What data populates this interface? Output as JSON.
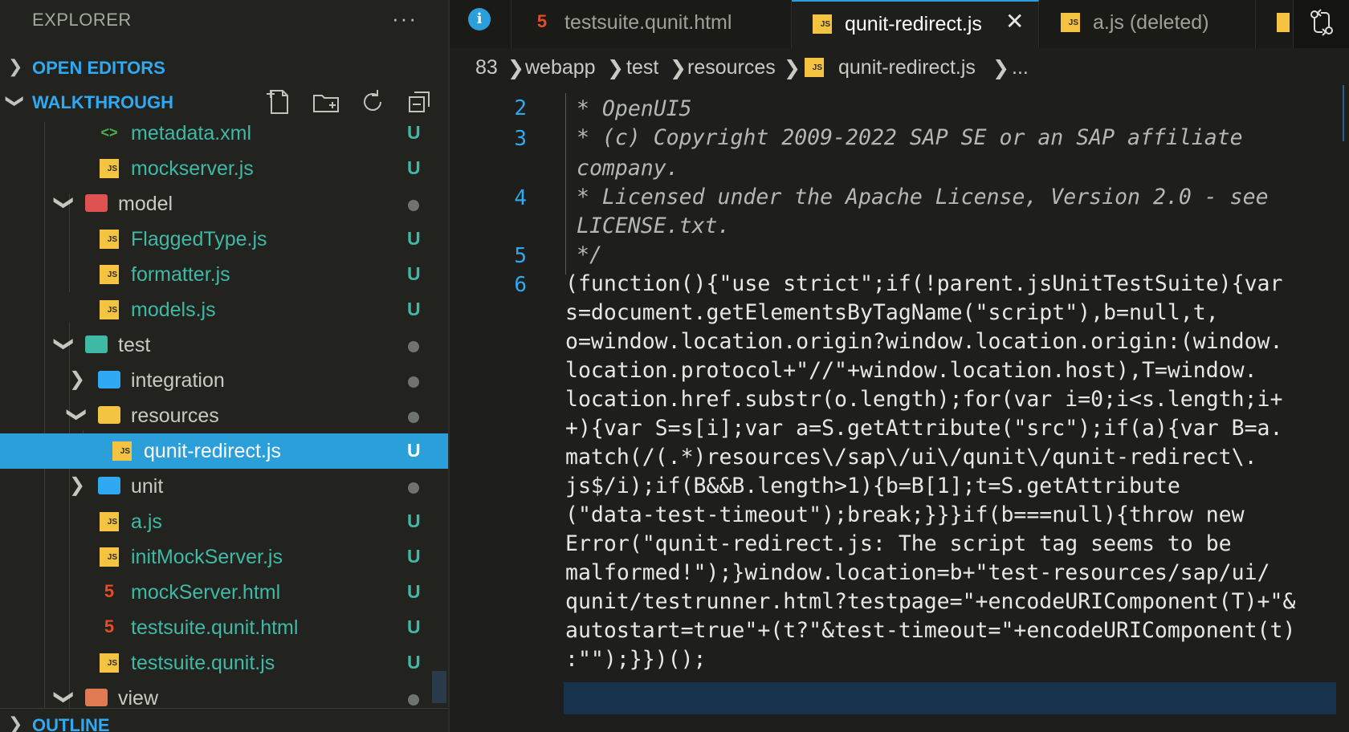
{
  "sidebar": {
    "title": "EXPLORER",
    "more": "···",
    "open_editors": "OPEN EDITORS",
    "walkthrough": "WALKTHROUGH",
    "outline": "OUTLINE",
    "tree": [
      {
        "name": "metadata.xml",
        "icon": "xml-file-icon",
        "status": "U",
        "color": "#3fb8a6"
      },
      {
        "name": "mockserver.js",
        "icon": "js-file-icon",
        "status": "U",
        "color": "#3fb8a6"
      },
      {
        "name": "model",
        "icon": "folder-red-open-icon",
        "status": "dot",
        "color": "#c8cbc4"
      },
      {
        "name": "FlaggedType.js",
        "icon": "js-file-icon",
        "status": "U",
        "color": "#3fb8a6"
      },
      {
        "name": "formatter.js",
        "icon": "js-file-icon",
        "status": "U",
        "color": "#3fb8a6"
      },
      {
        "name": "models.js",
        "icon": "js-file-icon",
        "status": "U",
        "color": "#3fb8a6"
      },
      {
        "name": "test",
        "icon": "folder-test-open-icon",
        "status": "dot",
        "color": "#c8cbc4"
      },
      {
        "name": "integration",
        "icon": "folder-blue-icon",
        "status": "dot",
        "color": "#c8cbc4"
      },
      {
        "name": "resources",
        "icon": "folder-yellow-open-icon",
        "status": "dot",
        "color": "#c8cbc4"
      },
      {
        "name": "qunit-redirect.js",
        "icon": "js-file-icon",
        "status": "U",
        "color": "#ffffff"
      },
      {
        "name": "unit",
        "icon": "folder-blue-icon",
        "status": "dot",
        "color": "#c8cbc4"
      },
      {
        "name": "a.js",
        "icon": "js-file-icon",
        "status": "U",
        "color": "#3fb8a6"
      },
      {
        "name": "initMockServer.js",
        "icon": "js-file-icon",
        "status": "U",
        "color": "#3fb8a6"
      },
      {
        "name": "mockServer.html",
        "icon": "html-file-icon",
        "status": "U",
        "color": "#3fb8a6"
      },
      {
        "name": "testsuite.qunit.html",
        "icon": "html-file-icon",
        "status": "U",
        "color": "#3fb8a6"
      },
      {
        "name": "testsuite.qunit.js",
        "icon": "js-file-icon",
        "status": "U",
        "color": "#3fb8a6"
      },
      {
        "name": "view",
        "icon": "folder-orange-open-icon",
        "status": "dot",
        "color": "#c8cbc4"
      }
    ]
  },
  "tabs": [
    {
      "label": "testsuite.qunit.html",
      "icon": "html-file-icon",
      "active": false
    },
    {
      "label": "qunit-redirect.js",
      "icon": "js-file-icon",
      "active": true
    },
    {
      "label": "a.js (deleted)",
      "icon": "js-file-icon",
      "active": false
    }
  ],
  "tab_close": "✕",
  "info_glyph": "i",
  "breadcrumb": [
    "83",
    "webapp",
    "test",
    "resources",
    "qunit-redirect.js",
    "..."
  ],
  "editor": {
    "line_numbers": [
      "2",
      "3",
      "4",
      "5",
      "6"
    ],
    "comment_lines": [
      "* OpenUI5",
      "* (c) Copyright 2009-2022 SAP SE or an SAP affiliate",
      "company.",
      "* Licensed under the Apache License, Version 2.0 - see",
      "LICENSE.txt.",
      "*/"
    ],
    "code_lines": [
      "(function(){\"use strict\";if(!parent.jsUnitTestSuite){var",
      "s=document.getElementsByTagName(\"script\"),b=null,t,",
      "o=window.location.origin?window.location.origin:(window.",
      "location.protocol+\"//\"+window.location.host),T=window.",
      "location.href.substr(o.length);for(var i=0;i<s.length;i+",
      "+){var S=s[i];var a=S.getAttribute(\"src\");if(a){var B=a.",
      "match(/(.*)resources\\/sap\\/ui\\/qunit\\/qunit-redirect\\.",
      "js$/i);if(B&&B.length>1){b=B[1];t=S.getAttribute",
      "(\"data-test-timeout\");break;}}}if(b===null){throw new",
      "Error(\"qunit-redirect.js: The script tag seems to be",
      "malformed!\");}window.location=b+\"test-resources/sap/ui/",
      "qunit/testrunner.html?testpage=\"+encodeURIComponent(T)+\"&",
      "autostart=true\"+(t?\"&test-timeout=\"+encodeURIComponent(t)",
      ":\"\");}})();"
    ]
  },
  "colors": {
    "accent": "#2a9fd9",
    "untracked": "#3fb8a6",
    "code_text": "#e8e8e2",
    "keyword": "#2ea9f2",
    "string": "#e6e3d6"
  }
}
